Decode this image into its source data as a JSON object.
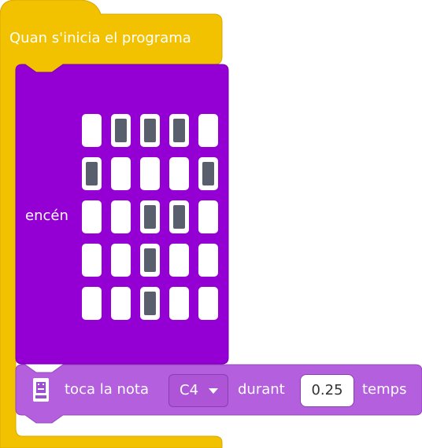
{
  "hat_block": {
    "label": "Quan s'inicia el programa",
    "color": "#f2c100"
  },
  "show_leds_block": {
    "label": "encén",
    "color": "#9400d3",
    "grid": [
      [
        0,
        1,
        1,
        1,
        0
      ],
      [
        1,
        0,
        0,
        0,
        1
      ],
      [
        0,
        0,
        1,
        1,
        0
      ],
      [
        0,
        0,
        1,
        0,
        0
      ],
      [
        0,
        0,
        1,
        0,
        0
      ]
    ]
  },
  "play_tone_block": {
    "icon": "microbit-board-icon",
    "label_play": "toca la nota",
    "note_value": "C4",
    "label_for": "durant",
    "beats_value": "0.25",
    "label_beats": "temps",
    "color": "#b35fde"
  }
}
